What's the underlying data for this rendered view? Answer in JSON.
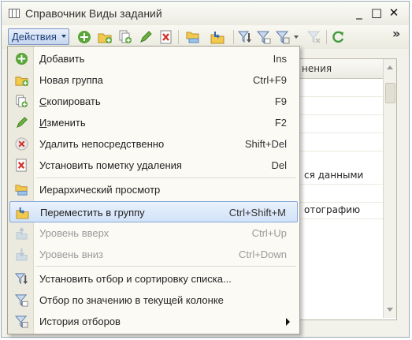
{
  "window": {
    "title": "Справочник Виды заданий",
    "buttons": [
      "_",
      "□",
      "✕"
    ]
  },
  "toolbar": {
    "actions_label": "Действия",
    "overflow": "»",
    "icons": [
      "add-icon",
      "new-group-icon",
      "copy-icon",
      "edit-icon",
      "delete-icon",
      "hierarchy-icon",
      "move-to-group-icon",
      "set-filter-icon",
      "filter-by-value-icon",
      "filter-history-icon",
      "clear-filter-icon",
      "refresh-icon"
    ]
  },
  "grid": {
    "header": "нения",
    "rows": [
      "",
      "",
      "",
      "",
      "ся данными",
      "",
      "отографию",
      "",
      "",
      "",
      "",
      "",
      ""
    ]
  },
  "menu": {
    "items": [
      {
        "label": "Добавить",
        "shortcut": "Ins",
        "icon": "add-icon",
        "enabled": true
      },
      {
        "label": "Новая группа",
        "shortcut": "Ctrl+F9",
        "icon": "new-group-icon",
        "enabled": true
      },
      {
        "label": "Скопировать",
        "shortcut": "F9",
        "icon": "copy-icon",
        "enabled": true
      },
      {
        "label": "Изменить",
        "shortcut": "F2",
        "icon": "edit-icon",
        "enabled": true
      },
      {
        "label": "Удалить непосредственно",
        "shortcut": "Shift+Del",
        "icon": "delete-direct-icon",
        "enabled": true
      },
      {
        "label": "Установить пометку удаления",
        "shortcut": "Del",
        "icon": "mark-delete-icon",
        "enabled": true
      },
      {
        "label": "Иерархический просмотр",
        "shortcut": "",
        "icon": "hierarchy-icon",
        "enabled": true
      },
      {
        "label": "Переместить в группу",
        "shortcut": "Ctrl+Shift+M",
        "icon": "move-to-group-icon",
        "enabled": true,
        "highlighted": true
      },
      {
        "label": "Уровень вверх",
        "shortcut": "Ctrl+Up",
        "icon": "level-up-icon",
        "enabled": false
      },
      {
        "label": "Уровень вниз",
        "shortcut": "Ctrl+Down",
        "icon": "level-down-icon",
        "enabled": false
      },
      {
        "label": "Установить отбор и сортировку списка...",
        "shortcut": "",
        "icon": "set-filter-icon",
        "enabled": true
      },
      {
        "label": "Отбор по значению в текущей колонке",
        "shortcut": "",
        "icon": "filter-by-value-icon",
        "enabled": true
      },
      {
        "label": "История отборов",
        "shortcut": "",
        "icon": "filter-history-icon",
        "enabled": true,
        "submenu": true
      }
    ]
  },
  "colors": {
    "accent_border": "#d9191e",
    "menu_highlight": "#d2e2f8",
    "add_green": "#5aa63a",
    "delete_red": "#d6312b"
  }
}
